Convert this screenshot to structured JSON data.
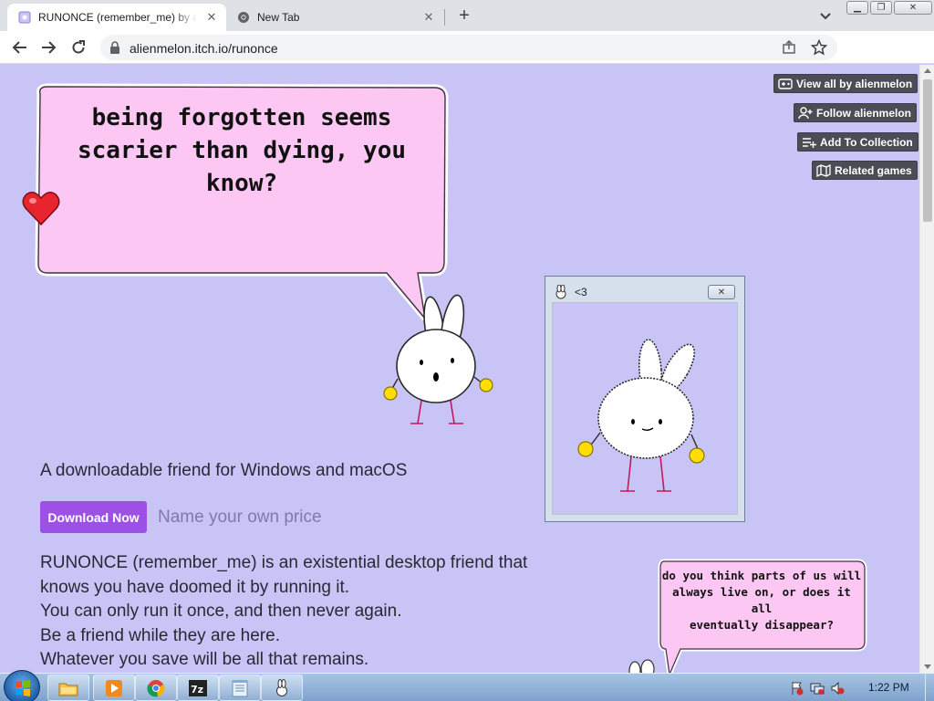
{
  "browser": {
    "tabs": [
      {
        "title": "RUNONCE (remember_me) by alienmelon",
        "active": true
      },
      {
        "title": "New Tab",
        "active": false
      }
    ],
    "url": "alienmelon.itch.io/runonce"
  },
  "page": {
    "top_buttons": [
      {
        "label": "View all by alienmelon",
        "icon": "gamepad-icon"
      },
      {
        "label": "Follow alienmelon",
        "icon": "user-plus-icon"
      },
      {
        "label": "Add To Collection",
        "icon": "playlist-add-icon"
      },
      {
        "label": "Related games",
        "icon": "map-icon"
      }
    ],
    "speech_bubble": {
      "line1": "being forgotten seems",
      "line2": "scarier than dying, you",
      "line3": "know?"
    },
    "pet_window": {
      "title": "<3",
      "close_symbol": "✕"
    },
    "small_bubble": {
      "line1": "do you think parts of us will",
      "line2": "always live on, or does it all",
      "line3": "eventually disappear?"
    },
    "tagline": "A downloadable friend for Windows and macOS",
    "download_label": "Download Now",
    "price_label": "Name your own price",
    "description": [
      "RUNONCE (remember_me) is an existential desktop friend that",
      "knows you have doomed it by running it.",
      "You can only run it once, and then never again.",
      "Be a friend while they are here.",
      "Whatever you save will be all that remains."
    ]
  },
  "colors": {
    "page_bg": "#c8c4f5",
    "bubble_fill": "#fcc8f3",
    "download_button": "#9c50e5",
    "itch_button": "#4a4d55"
  },
  "taskbar": {
    "items": [
      "explorer-icon",
      "media-player-icon",
      "chrome-icon",
      "7zip-icon",
      "notepad-icon",
      "bunny-app-icon"
    ],
    "clock": "1:22 PM"
  }
}
